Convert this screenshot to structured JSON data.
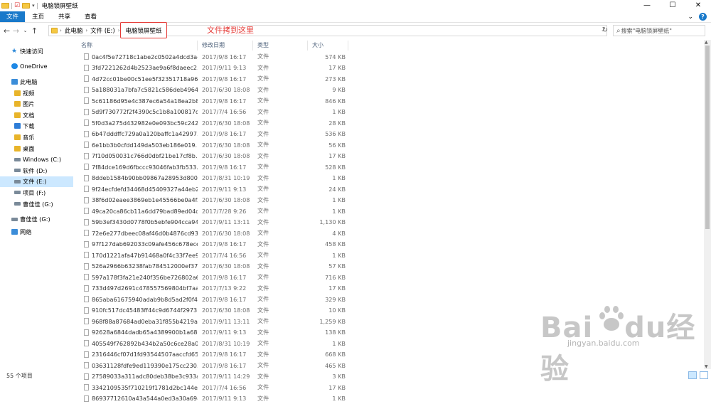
{
  "window": {
    "title": "电脑锁屏壁纸",
    "controls": [
      "—",
      "☐",
      "✕"
    ]
  },
  "ribbon": {
    "tabs": [
      {
        "label": "文件",
        "active": true
      },
      {
        "label": "主页",
        "active": false
      },
      {
        "label": "共享",
        "active": false
      },
      {
        "label": "查看",
        "active": false
      }
    ],
    "expand_icon": "chevron-down-icon",
    "help_label": "?"
  },
  "address": {
    "crumbs": [
      "此电脑",
      "文件 (E:)"
    ],
    "current": "电脑锁屏壁纸",
    "annotation": "文件拷到这里",
    "search_placeholder": "搜索\"电脑锁屏壁纸\""
  },
  "sidebar": {
    "items": [
      {
        "label": "快速访问",
        "icon": "star-icon",
        "indent": 0
      },
      {
        "label": "OneDrive",
        "icon": "cloud-icon",
        "indent": 0
      },
      {
        "label": "此电脑",
        "icon": "pc-icon",
        "indent": 0
      },
      {
        "label": "视频",
        "icon": "video-folder-icon",
        "indent": 1
      },
      {
        "label": "图片",
        "icon": "pictures-folder-icon",
        "indent": 1
      },
      {
        "label": "文档",
        "icon": "documents-folder-icon",
        "indent": 1
      },
      {
        "label": "下载",
        "icon": "download-folder-icon",
        "indent": 1
      },
      {
        "label": "音乐",
        "icon": "music-folder-icon",
        "indent": 1
      },
      {
        "label": "桌面",
        "icon": "desktop-folder-icon",
        "indent": 1
      },
      {
        "label": "Windows (C:)",
        "icon": "windows-drive-icon",
        "indent": 1
      },
      {
        "label": "软件 (D:)",
        "icon": "drive-icon",
        "indent": 1
      },
      {
        "label": "文件 (E:)",
        "icon": "drive-icon",
        "indent": 1,
        "selected": true
      },
      {
        "label": "项目 (F:)",
        "icon": "drive-icon",
        "indent": 1
      },
      {
        "label": "曹佳佳 (G:)",
        "icon": "drive-icon",
        "indent": 1
      },
      {
        "label": "曹佳佳 (G:)",
        "icon": "drive-icon",
        "indent": 0
      },
      {
        "label": "网络",
        "icon": "network-icon",
        "indent": 0
      }
    ]
  },
  "columns": {
    "name": "名称",
    "date": "修改日期",
    "type": "类型",
    "size": "大小"
  },
  "files": [
    {
      "name": "0ac4f5e72718c1abe2c0502a4dcd3ae...",
      "date": "2017/9/8 16:17",
      "type": "文件",
      "size": "574 KB"
    },
    {
      "name": "3fd7221262d4b2523ae9a6f8daeec2...",
      "date": "2017/9/11 9:13",
      "type": "文件",
      "size": "17 KB"
    },
    {
      "name": "4d72cc01be00c51ee5f32351718a96...",
      "date": "2017/9/8 16:17",
      "type": "文件",
      "size": "273 KB"
    },
    {
      "name": "5a188031a7bfa7c5821c586deb4964...",
      "date": "2017/6/30 18:08",
      "type": "文件",
      "size": "9 KB"
    },
    {
      "name": "5c61186d95e4c387ec6a54a18ea2b8...",
      "date": "2017/9/8 16:17",
      "type": "文件",
      "size": "846 KB"
    },
    {
      "name": "5d9f730772f2f4390c5c1b8a100817d...",
      "date": "2017/7/4 16:56",
      "type": "文件",
      "size": "1 KB"
    },
    {
      "name": "5f0d3a275d432982e0e093bc59c242...",
      "date": "2017/6/30 18:08",
      "type": "文件",
      "size": "28 KB"
    },
    {
      "name": "6b47dddffc729a0a120baffc1a42997...",
      "date": "2017/9/8 16:17",
      "type": "文件",
      "size": "536 KB"
    },
    {
      "name": "6e1bb3b0cfdd149da503eb186e019...",
      "date": "2017/6/30 18:08",
      "type": "文件",
      "size": "56 KB"
    },
    {
      "name": "7f10d050031c766d0dbf21be17cf8b...",
      "date": "2017/6/30 18:08",
      "type": "文件",
      "size": "17 KB"
    },
    {
      "name": "7f84dce169d6fbccc93046fab3fb533...",
      "date": "2017/9/8 16:17",
      "type": "文件",
      "size": "528 KB"
    },
    {
      "name": "8ddeb1584b90bb09867a28953d800...",
      "date": "2017/8/31 10:19",
      "type": "文件",
      "size": "1 KB"
    },
    {
      "name": "9f24ecfdefd34468d45409327a44eb2...",
      "date": "2017/9/11 9:13",
      "type": "文件",
      "size": "24 KB"
    },
    {
      "name": "38f6d02eaee3869eb1e45566be0a4f...",
      "date": "2017/6/30 18:08",
      "type": "文件",
      "size": "1 KB"
    },
    {
      "name": "49ca20ca86cb11a6dd79bad89ed04d...",
      "date": "2017/7/28 9:26",
      "type": "文件",
      "size": "1 KB"
    },
    {
      "name": "59b3ef3430d0778f0b5ebfe904cca94...",
      "date": "2017/9/11 13:11",
      "type": "文件",
      "size": "1,130 KB"
    },
    {
      "name": "72e6e277dbeec08af46d0b4876cd93...",
      "date": "2017/6/30 18:08",
      "type": "文件",
      "size": "4 KB"
    },
    {
      "name": "97f127dab692033c09afe456c678ece...",
      "date": "2017/9/8 16:17",
      "type": "文件",
      "size": "458 KB"
    },
    {
      "name": "170d1221afa47b91468a0f4c33f7ee9...",
      "date": "2017/7/4 16:56",
      "type": "文件",
      "size": "1 KB"
    },
    {
      "name": "526a2966b63238fab784512000ef37c...",
      "date": "2017/6/30 18:08",
      "type": "文件",
      "size": "57 KB"
    },
    {
      "name": "597a178f3fa21e240f356be726802a6...",
      "date": "2017/9/8 16:17",
      "type": "文件",
      "size": "716 KB"
    },
    {
      "name": "733d497d2691c478557569804bf7aa...",
      "date": "2017/7/13 9:22",
      "type": "文件",
      "size": "17 KB"
    },
    {
      "name": "865aba61675940adab9b8d5ad2f0f4f...",
      "date": "2017/9/8 16:17",
      "type": "文件",
      "size": "329 KB"
    },
    {
      "name": "910fc517dc45483ff44c9d6744f2973...",
      "date": "2017/6/30 18:08",
      "type": "文件",
      "size": "10 KB"
    },
    {
      "name": "968f88a87684ad0eba31f855b4219a...",
      "date": "2017/9/11 13:11",
      "type": "文件",
      "size": "1,259 KB"
    },
    {
      "name": "92628a6844dadb65a4389900b1a68e...",
      "date": "2017/9/11 9:13",
      "type": "文件",
      "size": "138 KB"
    },
    {
      "name": "405549f762892b434b2a50c6ce28a0...",
      "date": "2017/8/31 10:19",
      "type": "文件",
      "size": "1 KB"
    },
    {
      "name": "2316446cf07d1fd93544507aaccfd65...",
      "date": "2017/9/8 16:17",
      "type": "文件",
      "size": "668 KB"
    },
    {
      "name": "03631128fdfe9ed119390e175cc230...",
      "date": "2017/9/8 16:17",
      "type": "文件",
      "size": "465 KB"
    },
    {
      "name": "27589033a311adc80deb38be3c933a...",
      "date": "2017/9/11 14:29",
      "type": "文件",
      "size": "3 KB"
    },
    {
      "name": "3342109535f710219f1781d2bc144e...",
      "date": "2017/7/4 16:56",
      "type": "文件",
      "size": "17 KB"
    },
    {
      "name": "86937712610a43a544a0ed3a30a694...",
      "date": "2017/9/11 9:13",
      "type": "文件",
      "size": "1 KB"
    }
  ],
  "status": {
    "count": "55 个项目"
  },
  "watermark": {
    "brand": "Bai",
    "brand2": "du",
    "cn": "经验",
    "url": "jingyan.baidu.com"
  }
}
